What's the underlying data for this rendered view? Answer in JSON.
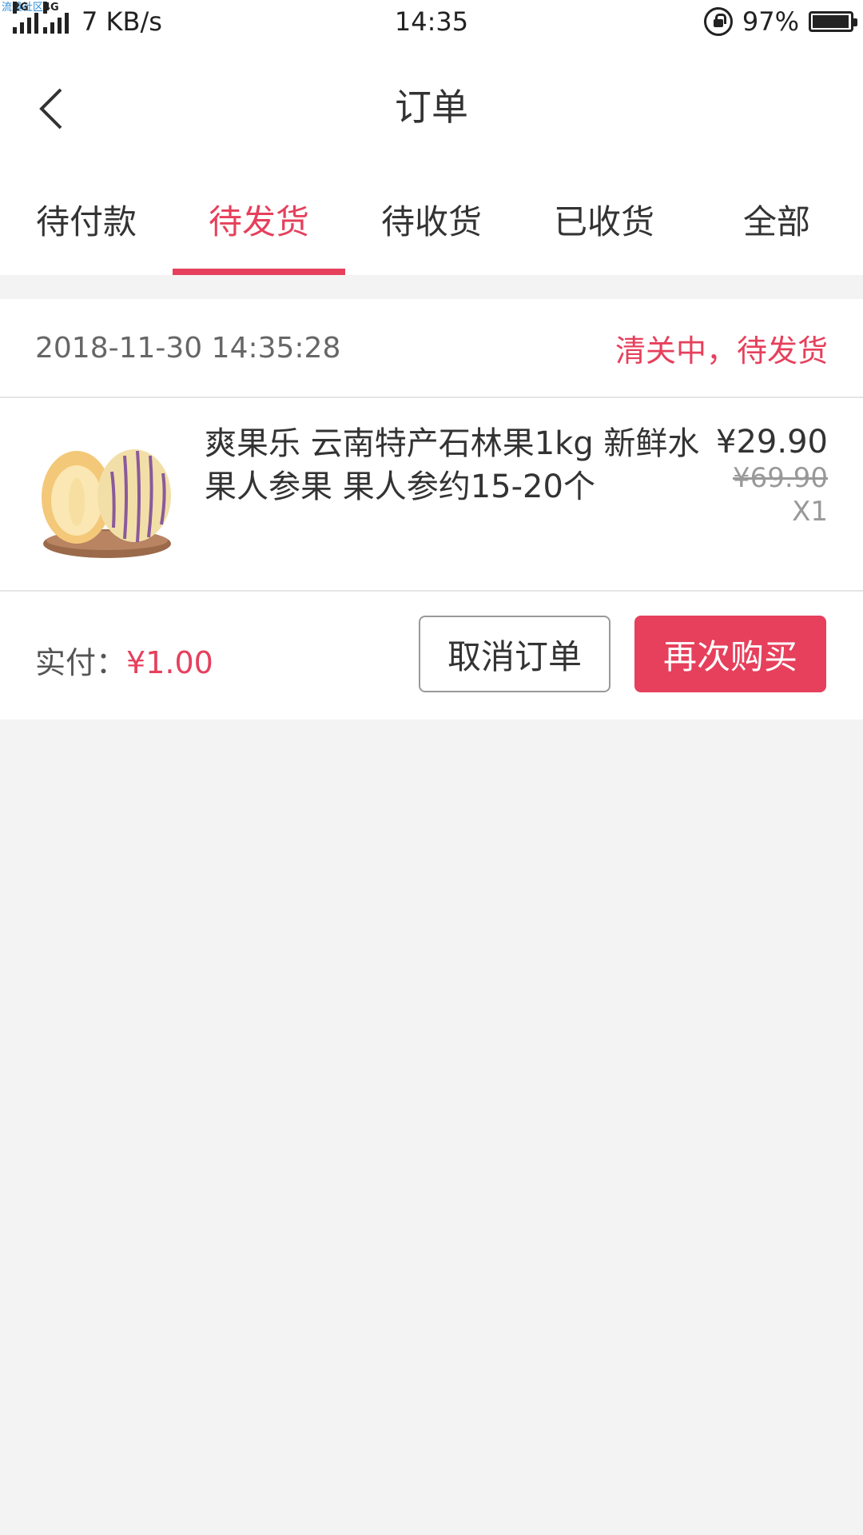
{
  "status_bar": {
    "watermark": "流量社区",
    "net1": "2G",
    "net2": "4G",
    "speed": "7 KB/s",
    "time": "14:35",
    "battery": "97%"
  },
  "nav": {
    "title": "订单",
    "back_icon": "back-chevron-icon"
  },
  "tabs": [
    {
      "label": "待付款",
      "active": false
    },
    {
      "label": "待发货",
      "active": true
    },
    {
      "label": "待收货",
      "active": false
    },
    {
      "label": "已收货",
      "active": false
    },
    {
      "label": "全部",
      "active": false
    }
  ],
  "order": {
    "time": "2018-11-30 14:35:28",
    "status": "清关中，待发货",
    "item": {
      "title": "爽果乐 云南特产石林果1kg 新鲜水果人参果 果人参约15-20个",
      "price_now": "¥29.90",
      "price_old": "¥69.90",
      "qty": "X1"
    },
    "paid_label": "实付：",
    "paid_amount": "¥1.00",
    "cancel_label": "取消订单",
    "rebuy_label": "再次购买"
  },
  "colors": {
    "accent": "#e6405c"
  }
}
